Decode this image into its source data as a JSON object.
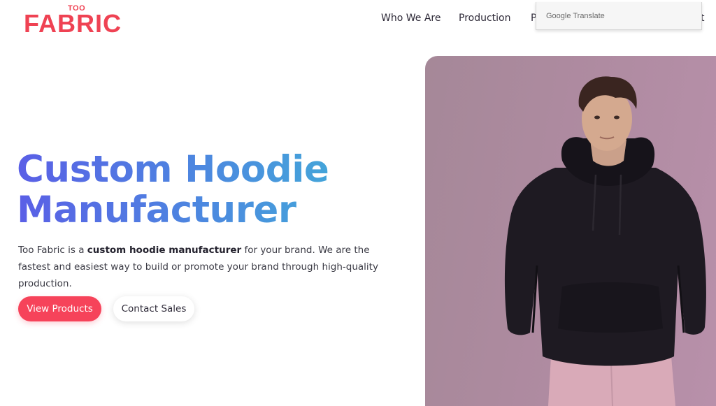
{
  "brand": {
    "small": "TOO",
    "main": "FABRIC",
    "color": "#ef4253"
  },
  "nav": {
    "items": [
      {
        "label": "Who We Are"
      },
      {
        "label": "Production"
      },
      {
        "label": "P"
      },
      {
        "label": "t"
      }
    ]
  },
  "translate_popup": {
    "brand": "Google",
    "label": "Translate"
  },
  "hero": {
    "title_line1": "Custom Hoodie",
    "title_line2": "Manufacturer",
    "desc_part1": "Too Fabric is a ",
    "desc_bold": "custom hoodie manufacturer",
    "desc_part2": " for your brand. We are the fastest and easiest way to build or promote your brand through high-quality production.",
    "primary_button": "View Products",
    "secondary_button": "Contact Sales",
    "gradient_colors": [
      "#5a5fe6",
      "#4d86e0",
      "#3fb6d6"
    ],
    "primary_color": "#f6435a",
    "image_alt_icon": "model-in-black-hoodie-photo"
  }
}
